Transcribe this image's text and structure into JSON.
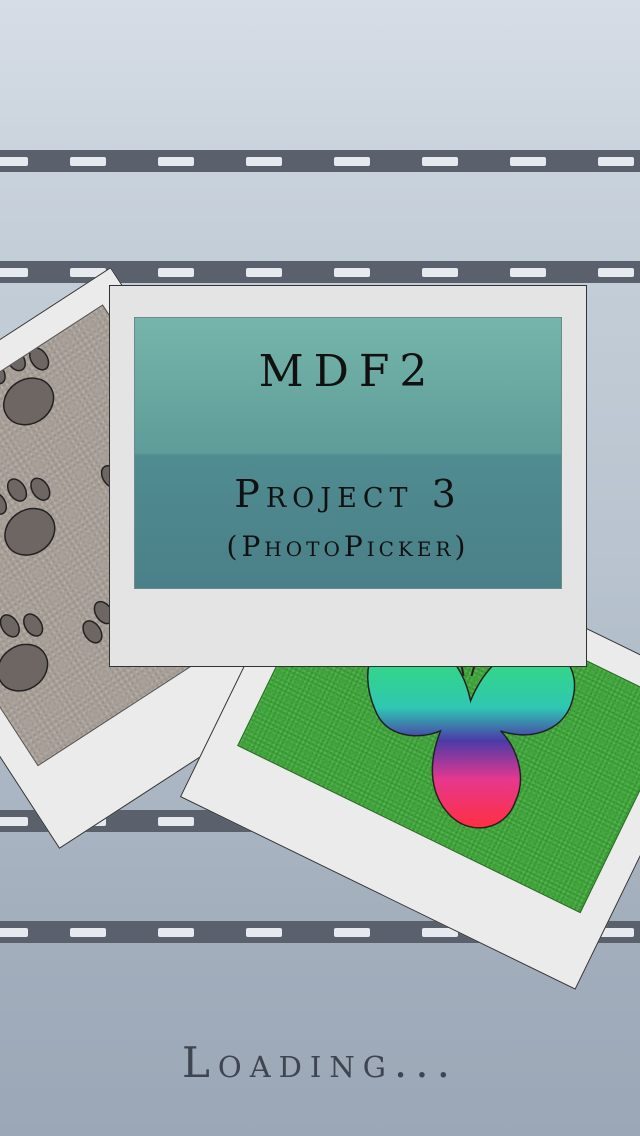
{
  "splash": {
    "app_title": "MDF2",
    "project_title": "Project 3",
    "project_subtitle": "(PhotoPicker)",
    "loading_text": "Loading..."
  },
  "photos": {
    "left_photo_subject": "paw-prints",
    "right_photo_subject": "butterfly"
  },
  "colors": {
    "background_top": "#d6dde6",
    "background_bottom": "#9ba7b6",
    "film_strip": "#5b616c",
    "title_card_top": "#76b5ab",
    "title_card_bottom": "#4b8088",
    "paw_photo": "#a8a098",
    "butterfly_photo": "#3fa83a"
  }
}
